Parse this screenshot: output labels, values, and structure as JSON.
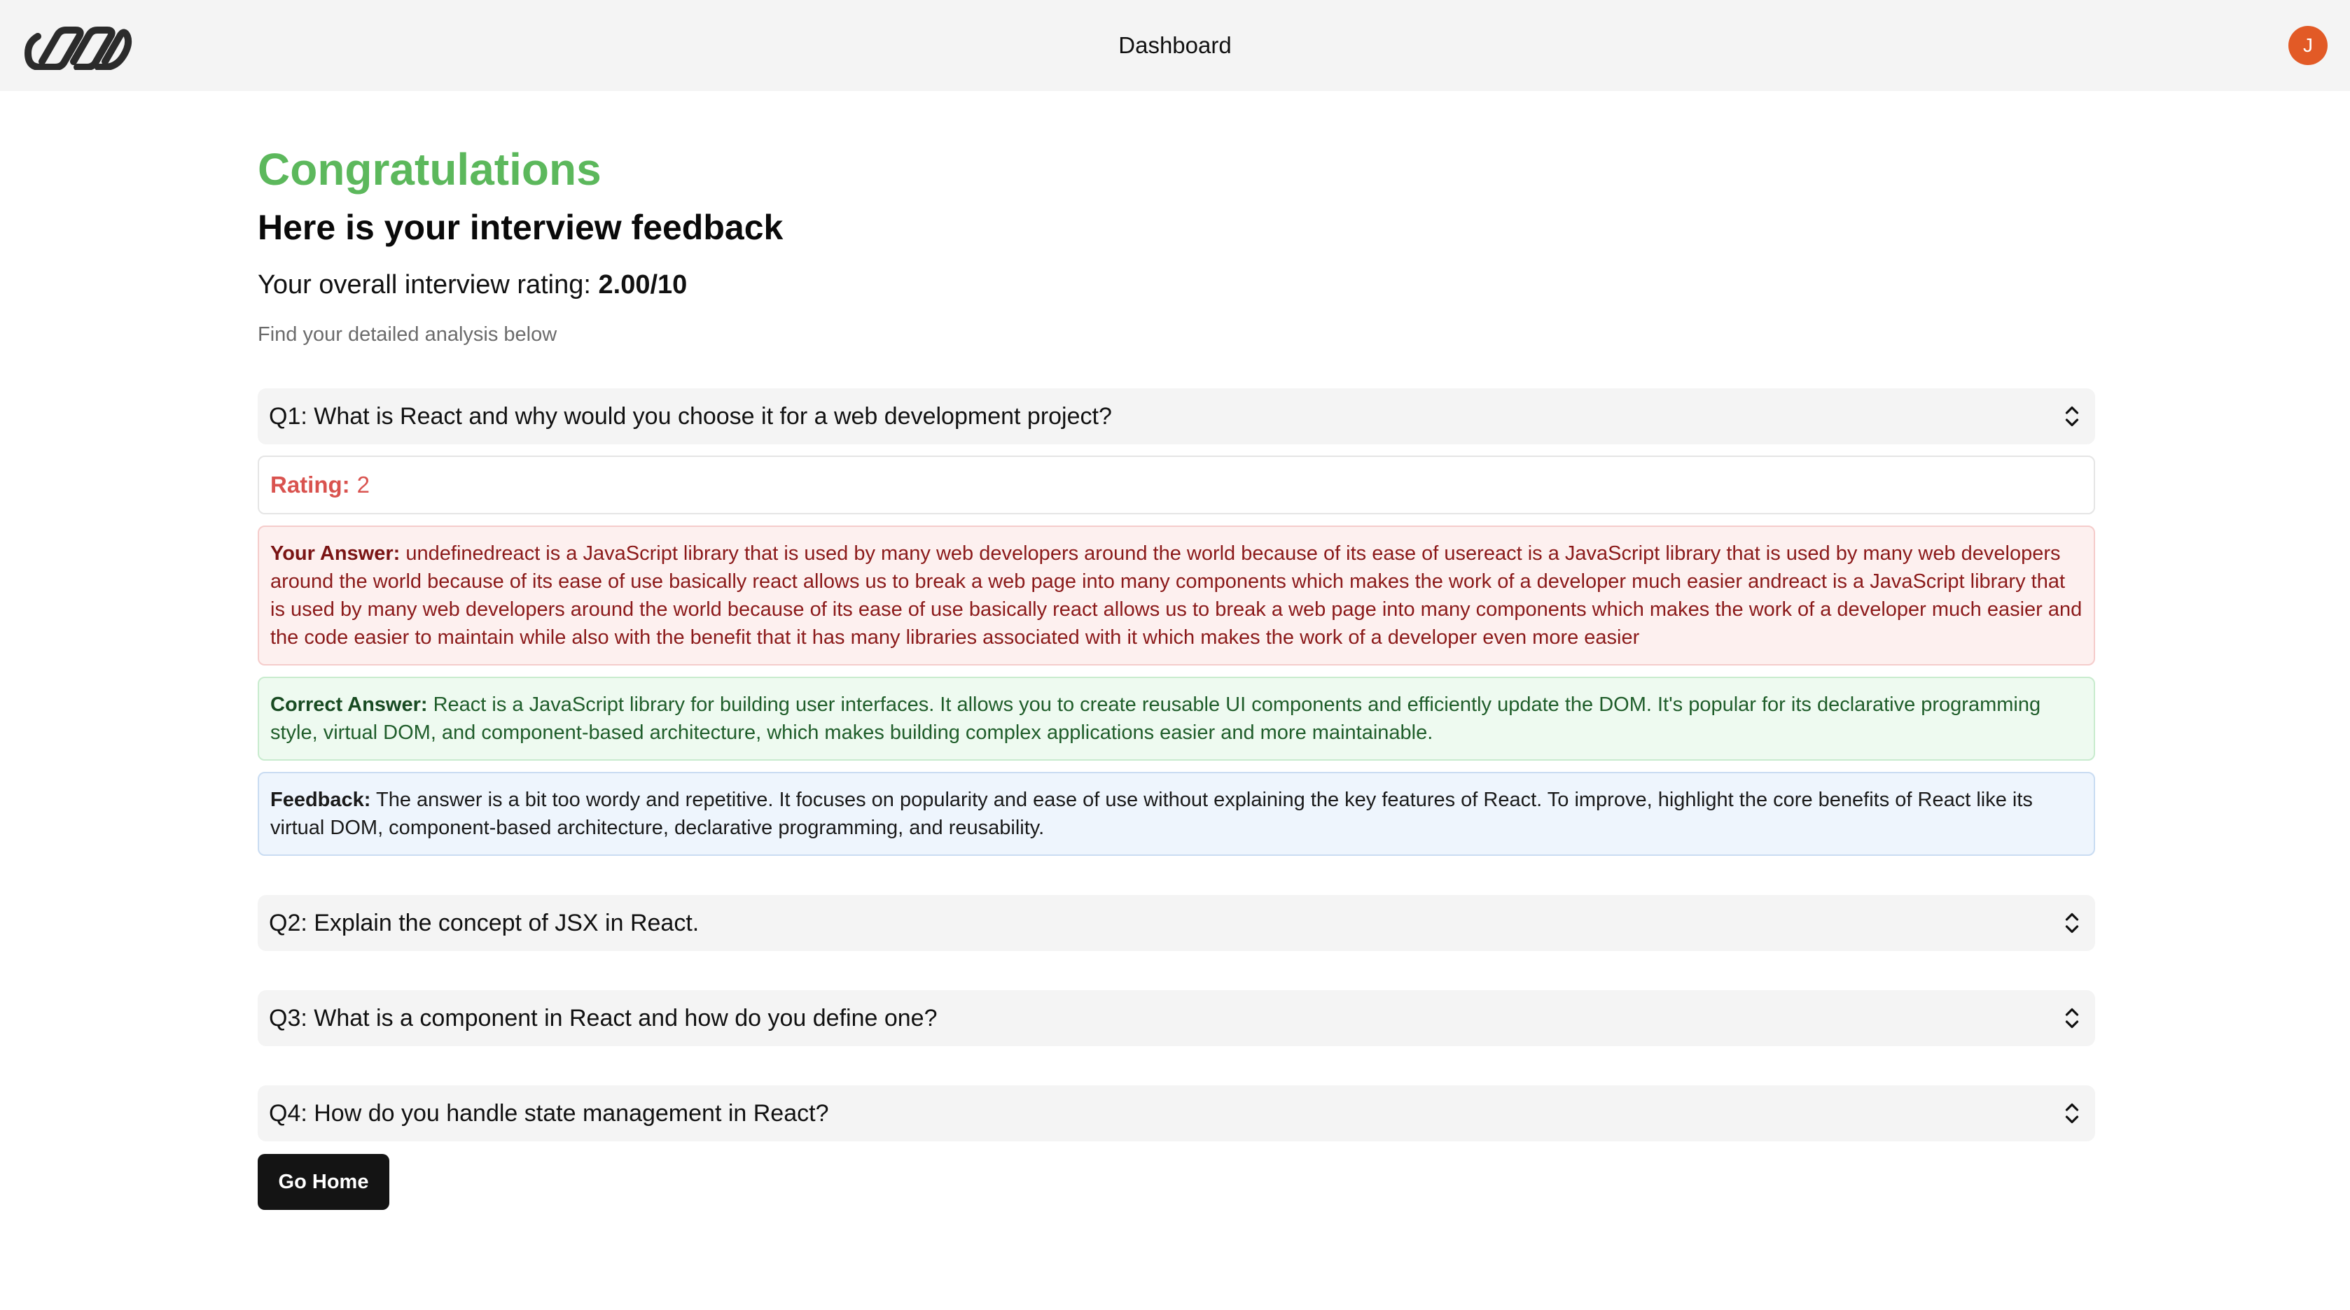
{
  "navbar": {
    "title": "Dashboard",
    "avatar_initial": "J"
  },
  "main": {
    "congrats": "Congratulations",
    "subtitle": "Here is your interview feedback",
    "overall_label": "Your overall interview rating: ",
    "overall_value": "2.00/10",
    "hint": "Find your detailed analysis below"
  },
  "questions": [
    {
      "title": "Q1: What is React and why would you choose it for a web development project?",
      "expanded": true,
      "rating_label": "Rating:",
      "rating_value": "2",
      "answer_label": "Your Answer:",
      "answer_text": "undefinedreact is a JavaScript library that is used by many web developers around the world because of its ease of usereact is a JavaScript library that is used by many web developers around the world because of its ease of use basically react allows us to break a web page into many components which makes the work of a developer much easier andreact is a JavaScript library that is used by many web developers around the world because of its ease of use basically react allows us to break a web page into many components which makes the work of a developer much easier and the code easier to maintain while also with the benefit that it has many libraries associated with it which makes the work of a developer even more easier",
      "correct_label": "Correct Answer:",
      "correct_text": "React is a JavaScript library for building user interfaces. It allows you to create reusable UI components and efficiently update the DOM. It's popular for its declarative programming style, virtual DOM, and component-based architecture, which makes building complex applications easier and more maintainable.",
      "feedback_label": "Feedback:",
      "feedback_text": "The answer is a bit too wordy and repetitive. It focuses on popularity and ease of use without explaining the key features of React. To improve, highlight the core benefits of React like its virtual DOM, component-based architecture, declarative programming, and reusability."
    },
    {
      "title": "Q2: Explain the concept of JSX in React.",
      "expanded": false
    },
    {
      "title": "Q3: What is a component in React and how do you define one?",
      "expanded": false
    },
    {
      "title": "Q4: How do you handle state management in React?",
      "expanded": false
    }
  ],
  "actions": {
    "go_home_label": "Go Home"
  },
  "colors": {
    "accent_green": "#5cb85c",
    "rating_red": "#d9534f",
    "avatar_orange": "#e25a26",
    "button_dark": "#141414"
  }
}
